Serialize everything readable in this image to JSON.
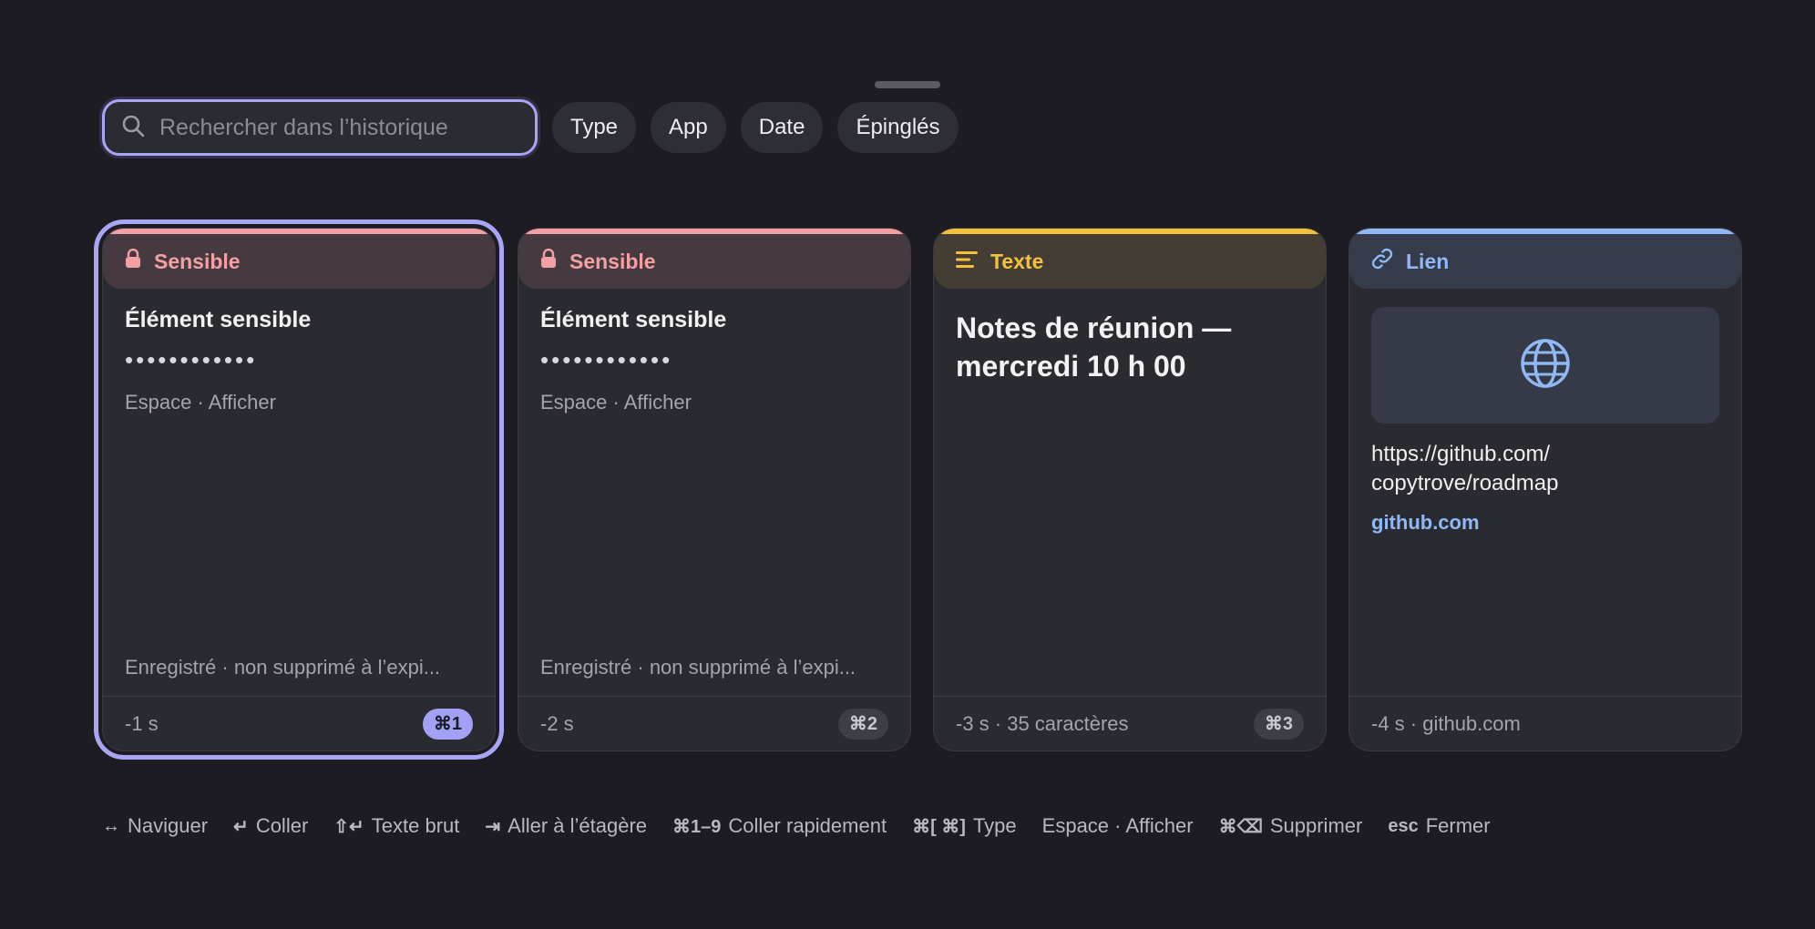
{
  "search": {
    "placeholder": "Rechercher dans l’historique",
    "value": ""
  },
  "filters": [
    "Type",
    "App",
    "Date",
    "Épinglés"
  ],
  "cards": [
    {
      "tag": "Sensible",
      "tag_icon": "lock-icon",
      "accent": "#f2a0a4",
      "title": "Élément sensible",
      "masked": "••••••••••••",
      "hint": "Espace · Afficher",
      "saved": "Enregistré · non supprimé à l’expi...",
      "meta": "-1 s",
      "shortcut": "⌘1",
      "selected": true
    },
    {
      "tag": "Sensible",
      "tag_icon": "lock-icon",
      "accent": "#f2a0a4",
      "title": "Élément sensible",
      "masked": "••••••••••••",
      "hint": "Espace · Afficher",
      "saved": "Enregistré · non supprimé à l’expi...",
      "meta": "-2 s",
      "shortcut": "⌘2",
      "selected": false
    },
    {
      "tag": "Texte",
      "tag_icon": "text-lines-icon",
      "accent": "#f3c13a",
      "title": "Notes de réunion — mercredi 10 h 00",
      "meta": "-3 s · 35 caractères",
      "shortcut": "⌘3",
      "selected": false
    },
    {
      "tag": "Lien",
      "tag_icon": "link-icon",
      "accent": "#8fb8f5",
      "url": "https://github.com/ copytrove/roadmap",
      "domain": "github.com",
      "meta": "-4 s · github.com",
      "selected": false
    }
  ],
  "shortcuts": [
    {
      "key": "↔",
      "label": "Naviguer"
    },
    {
      "key": "↵",
      "label": "Coller"
    },
    {
      "key": "⇧↵",
      "label": "Texte brut"
    },
    {
      "key": "⇥",
      "label": "Aller à l’étagère"
    },
    {
      "key": "⌘1–9",
      "label": "Coller rapidement"
    },
    {
      "key": "⌘[ ⌘]",
      "label": "Type"
    },
    {
      "key": "",
      "label": "Espace · Afficher"
    },
    {
      "key": "⌘⌫",
      "label": "Supprimer"
    },
    {
      "key": "esc",
      "label": "Fermer"
    }
  ]
}
